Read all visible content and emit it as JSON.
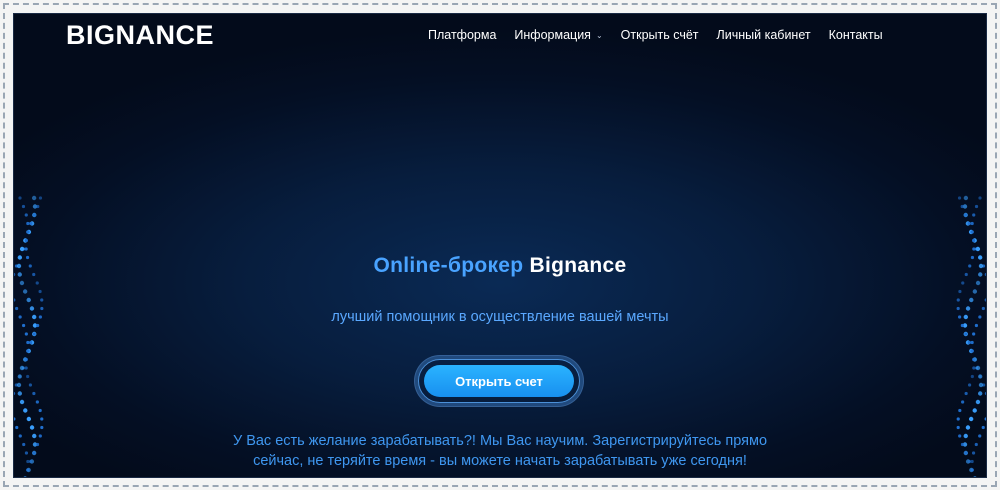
{
  "brand": {
    "logo_text": "BIGNANCE"
  },
  "nav": {
    "items": [
      {
        "label": "Платформа"
      },
      {
        "label": "Информация",
        "has_dropdown": true
      },
      {
        "label": "Открыть счёт"
      },
      {
        "label": "Личный кабинет"
      },
      {
        "label": "Контакты"
      }
    ]
  },
  "hero": {
    "headline_accent": "Online-брокер",
    "headline_brand": "Bignance",
    "tagline": "лучший помощник в осуществление вашей мечты",
    "cta_label": "Открыть счет",
    "description_line1": "У Вас есть желание зарабатывать?! Мы Вас научим. Зарегистрируйтесь прямо",
    "description_line2": "сейчас, не теряйте время - вы можете начать зарабатывать уже сегодня!"
  },
  "colors": {
    "background": "#061a38",
    "accent": "#49a3ff",
    "button": "#1e9cf5",
    "text": "#ffffff"
  },
  "icons": {
    "dropdown": "chevron-down-icon",
    "decor": "dot-wave-decoration"
  }
}
